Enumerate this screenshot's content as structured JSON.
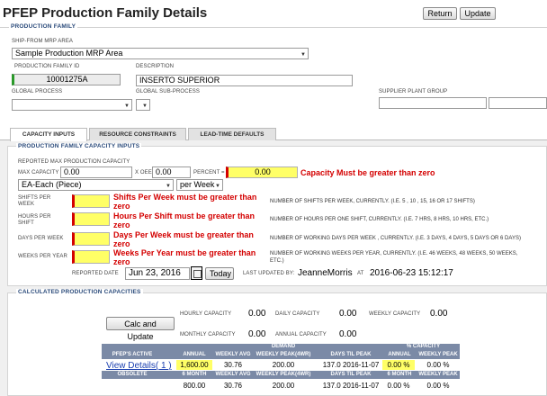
{
  "header": {
    "title": "PFEP Production Family Details",
    "return_label": "Return",
    "update_label": "Update"
  },
  "family": {
    "section": "PRODUCTION FAMILY",
    "ship_from_label": "SHIP-FROM MRP AREA",
    "ship_from_value": "Sample Production MRP Area",
    "id_label": "PRODUCTION FAMILY ID",
    "id_value": "10001275A",
    "desc_label": "DESCRIPTION",
    "desc_value": "INSERTO SUPERIOR",
    "global_process_label": "GLOBAL PROCESS",
    "global_subprocess_label": "GLOBAL SUB-PROCESS",
    "supplier_plant_label": "SUPPLIER PLANT GROUP"
  },
  "tabs": [
    "CAPACITY INPUTS",
    "RESOURCE CONSTRAINTS",
    "LEAD-TIME DEFAULTS"
  ],
  "capacity": {
    "section": "PRODUCTION FAMILY CAPACITY INPUTS",
    "reported_max_label": "REPORTED MAX PRODUCTION CAPACITY",
    "max_capacity_label": "MAX CAPACITY",
    "max_capacity_value": "0.00",
    "xoee_label": "X OEE",
    "xoee_value": "0.00",
    "percent_label": "PERCENT =",
    "percent_value": "0.00",
    "capacity_error": "Capacity Must be greater than zero",
    "unit_value": "EA-Each (Piece)",
    "per_value": "per Week",
    "shifts_label": "SHIFTS PER WEEK",
    "shifts_error": "Shifts Per Week must be greater than zero",
    "shifts_desc": "NUMBER OF SHIFTS PER WEEK, CURRENTLY. (I.E. 5 , 10 , 15, 16 OR 17 SHIFTS)",
    "hours_label": "HOURS PER SHIFT",
    "hours_error": "Hours Per Shift must be greater than zero",
    "hours_desc": "NUMBER OF HOURS PER ONE SHIFT, CURRENTLY. (I.E. 7 HRS, 8 HRS, 10 HRS, ETC.)",
    "days_label": "DAYS PER WEEK",
    "days_error": "Days Per Week must be greater than zero",
    "days_desc": "NUMBER OF WORKING DAYS PER WEEK , CURRENTLY. (I.E. 3 DAYS, 4 DAYS, 5 DAYS OR 6 DAYS)",
    "weeks_label": "WEEKS PER YEAR",
    "weeks_error": "Weeks Per Year must be greater than zero",
    "weeks_desc_1": "NUMBER OF WORKING WEEKS PER YEAR, CURRENTLY. (I.E. 46 WEEKS, 48 WEEKS, 50 WEEKS,",
    "weeks_desc_2": "ETC.)",
    "reported_date_label": "REPORTED DATE",
    "reported_date_value": "Jun 23, 2016",
    "today_label": "Today",
    "last_updated_label": "LAST UPDATED BY:",
    "last_updated_user": "JeanneMorris",
    "at_label": "AT",
    "last_updated_time": "2016-06-23 15:12:17"
  },
  "calc": {
    "section": "CALCULATED PRODUCTION CAPACITIES",
    "button": "Calc and Update",
    "hourly_label": "HOURLY CAPACITY",
    "hourly_value": "0.00",
    "daily_label": "DAILY CAPACITY",
    "daily_value": "0.00",
    "weekly_label": "WEEKLY CAPACITY",
    "weekly_value": "0.00",
    "monthly_label": "MONTHLY CAPACITY",
    "monthly_value": "0.00",
    "annual_label": "ANNUAL CAPACITY",
    "annual_value": "0.00"
  },
  "table": {
    "active_label": "PFEP'S ACTIVE",
    "obsolete_label": "OBSOLETE",
    "demand_label": "DEMAND",
    "pct_capacity_label": "% CAPACITY",
    "cols_top": [
      "ANNUAL",
      "WEEKLY AVG",
      "WEEKLY PEAK(4WR)",
      "DAYS TIL PEAK",
      "ANNUAL",
      "WEEKLY PEAK"
    ],
    "cols_bottom": [
      "6 MONTH",
      "WEEKLY AVG",
      "WEEKLY PEAK(4WR)",
      "DAYS TIL PEAK",
      "6 MONTH",
      "WEEKLY PEAK"
    ],
    "view_details": "View Details( 1 )",
    "row1": [
      "1,600.00",
      "30.76",
      "200.00",
      "137.0  2016-11-07",
      "0.00 %",
      "0.00 %"
    ],
    "row2": [
      "800.00",
      "30.76",
      "200.00",
      "137.0  2016-11-07",
      "0.00 %",
      "0.00 %"
    ]
  }
}
